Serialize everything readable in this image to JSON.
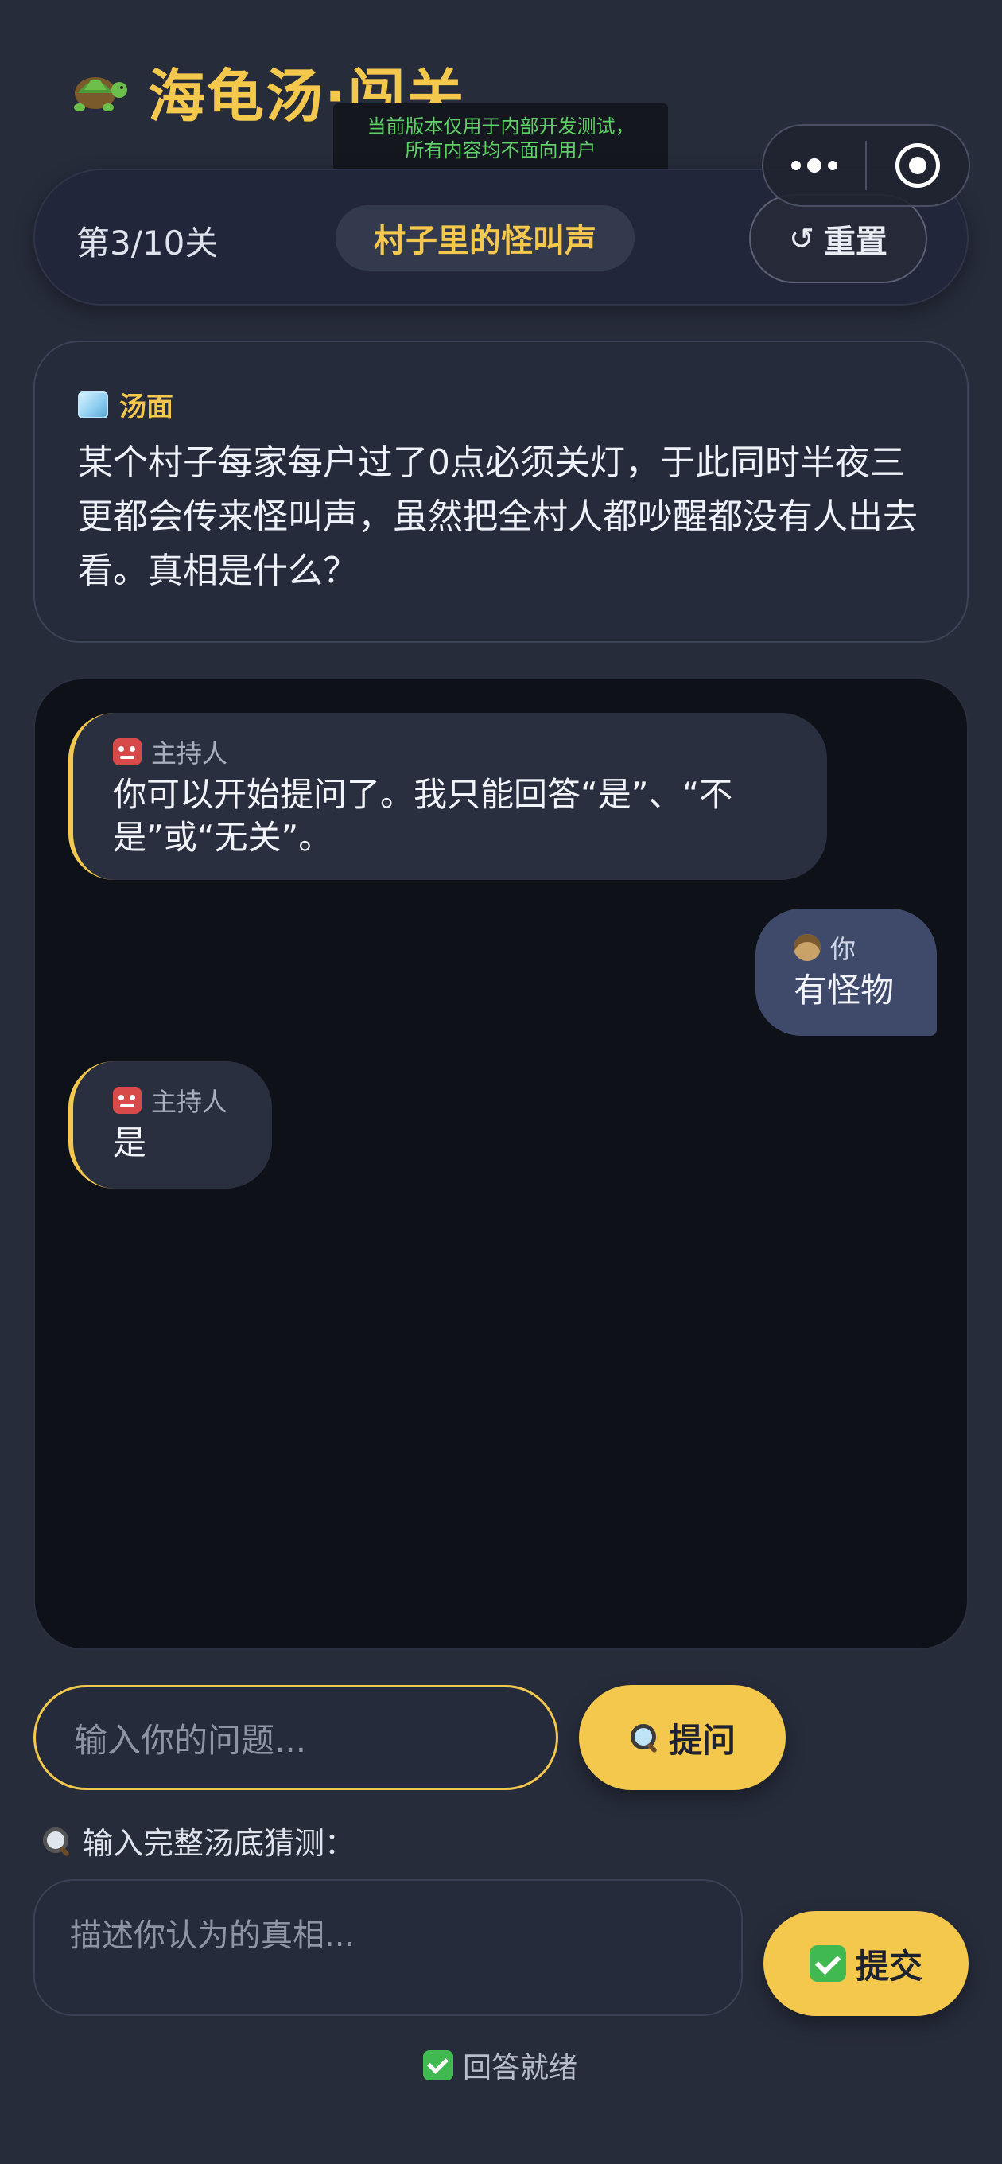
{
  "header": {
    "title": "海龟汤·闯关",
    "icon": "turtle-icon",
    "dev_notice_line1": "当前版本仅用于内部开发测试，",
    "dev_notice_line2": "所有内容均不面向用户"
  },
  "level": {
    "progress": "第3/10关",
    "current": 3,
    "total": 10,
    "name": "村子里的怪叫声",
    "reset_label": "重置",
    "reset_icon": "↺"
  },
  "riddle": {
    "label": "汤面",
    "icon": "ice-cube-icon",
    "text": "某个村子每家每户过了0点必须关灯，于此同时半夜三更都会传来怪叫声，虽然把全村人都吵醒都没有人出去看。真相是什么？"
  },
  "chat": {
    "messages": [
      {
        "role": "host",
        "sender": "主持人",
        "text": "你可以开始提问了。我只能回答“是”、“不是”或“无关”。"
      },
      {
        "role": "user",
        "sender": "你",
        "text": "有怪物"
      },
      {
        "role": "host",
        "sender": "主持人",
        "text": "是"
      }
    ]
  },
  "question": {
    "placeholder": "输入你的问题...",
    "ask_label": "提问"
  },
  "guess": {
    "label": "输入完整汤底猜测：",
    "placeholder": "描述你认为的真相...",
    "submit_label": "提交"
  },
  "status": {
    "text": "回答就绪"
  },
  "colors": {
    "accent": "#f3c84c",
    "background": "#272c3b",
    "chat_background": "#0e1118",
    "user_bubble": "#3f4a6a",
    "host_bubble": "#2a2f3f",
    "success": "#3fb950",
    "dev_notice": "#5fd068"
  }
}
